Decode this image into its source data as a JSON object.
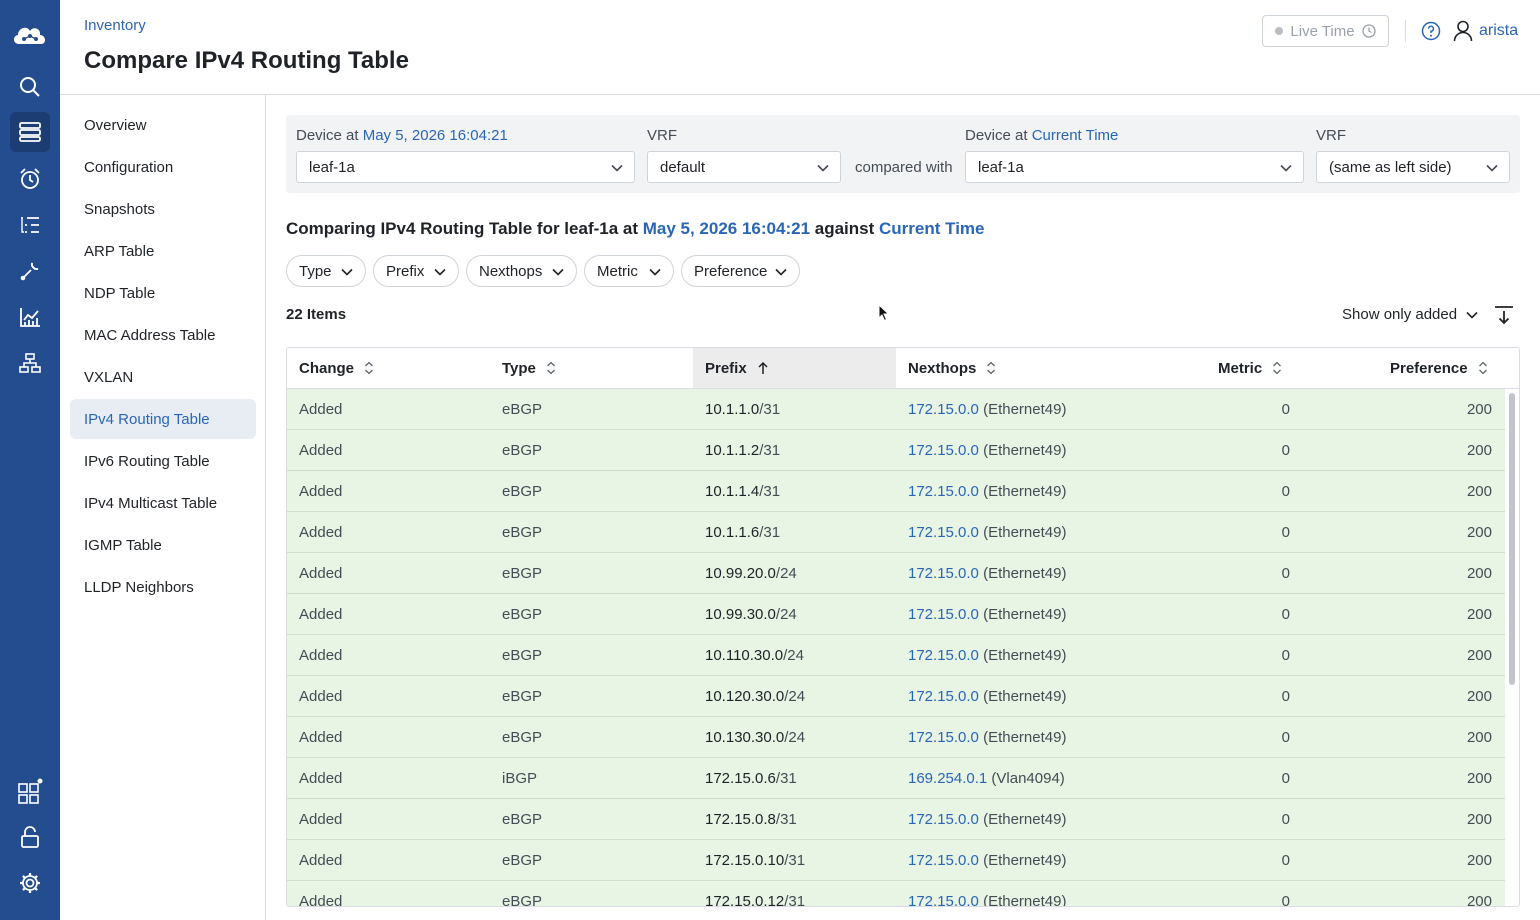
{
  "rail": {
    "items": [
      {
        "name": "cloud-logo-icon"
      },
      {
        "name": "search-icon"
      },
      {
        "name": "devices-icon"
      },
      {
        "name": "events-icon"
      },
      {
        "name": "tasks-icon"
      },
      {
        "name": "provisioning-icon"
      },
      {
        "name": "dashboards-icon"
      },
      {
        "name": "topology-icon"
      },
      {
        "name": "apps-icon"
      },
      {
        "name": "lock-icon"
      },
      {
        "name": "settings-icon"
      }
    ]
  },
  "header": {
    "breadcrumb": "Inventory",
    "title": "Compare IPv4 Routing Table",
    "live_time": "Live Time",
    "user": "arista"
  },
  "subnav": {
    "items": [
      "Overview",
      "Configuration",
      "Snapshots",
      "ARP Table",
      "NDP Table",
      "MAC Address Table",
      "VXLAN",
      "IPv4 Routing Table",
      "IPv6 Routing Table",
      "IPv4 Multicast Table",
      "IGMP Table",
      "LLDP Neighbors"
    ],
    "active": "IPv4 Routing Table"
  },
  "selectors": {
    "left_device_label": "Device at ",
    "left_device_time": "May 5, 2026 16:04:21",
    "left_device_value": "leaf-1a",
    "left_vrf_label": "VRF",
    "left_vrf_value": "default",
    "compared_with": "compared with",
    "right_device_label": "Device at ",
    "right_device_time": "Current Time",
    "right_device_value": "leaf-1a",
    "right_vrf_label": "VRF",
    "right_vrf_value": "(same as left side)"
  },
  "comparison": {
    "prefix": "Comparing IPv4 Routing Table for leaf-1a at ",
    "time_a": "May 5, 2026 16:04:21",
    "against": " against ",
    "time_b": "Current Time"
  },
  "filters": [
    "Type",
    "Prefix",
    "Nexthops",
    "Metric",
    "Preference"
  ],
  "list": {
    "count": "22 Items",
    "show_filter": "Show only added"
  },
  "table": {
    "columns": [
      "Change",
      "Type",
      "Prefix",
      "Nexthops",
      "Metric",
      "Preference"
    ],
    "sorted_column": "Prefix",
    "rows": [
      {
        "change": "Added",
        "type": "eBGP",
        "prefix_ip": "10.1.1.0",
        "prefix_len": "/31",
        "hop_ip": "172.15.0.0",
        "hop_if": " (Ethernet49)",
        "metric": "0",
        "pref": "200"
      },
      {
        "change": "Added",
        "type": "eBGP",
        "prefix_ip": "10.1.1.2",
        "prefix_len": "/31",
        "hop_ip": "172.15.0.0",
        "hop_if": " (Ethernet49)",
        "metric": "0",
        "pref": "200"
      },
      {
        "change": "Added",
        "type": "eBGP",
        "prefix_ip": "10.1.1.4",
        "prefix_len": "/31",
        "hop_ip": "172.15.0.0",
        "hop_if": " (Ethernet49)",
        "metric": "0",
        "pref": "200"
      },
      {
        "change": "Added",
        "type": "eBGP",
        "prefix_ip": "10.1.1.6",
        "prefix_len": "/31",
        "hop_ip": "172.15.0.0",
        "hop_if": " (Ethernet49)",
        "metric": "0",
        "pref": "200"
      },
      {
        "change": "Added",
        "type": "eBGP",
        "prefix_ip": "10.99.20.0",
        "prefix_len": "/24",
        "hop_ip": "172.15.0.0",
        "hop_if": " (Ethernet49)",
        "metric": "0",
        "pref": "200"
      },
      {
        "change": "Added",
        "type": "eBGP",
        "prefix_ip": "10.99.30.0",
        "prefix_len": "/24",
        "hop_ip": "172.15.0.0",
        "hop_if": " (Ethernet49)",
        "metric": "0",
        "pref": "200"
      },
      {
        "change": "Added",
        "type": "eBGP",
        "prefix_ip": "10.110.30.0",
        "prefix_len": "/24",
        "hop_ip": "172.15.0.0",
        "hop_if": " (Ethernet49)",
        "metric": "0",
        "pref": "200"
      },
      {
        "change": "Added",
        "type": "eBGP",
        "prefix_ip": "10.120.30.0",
        "prefix_len": "/24",
        "hop_ip": "172.15.0.0",
        "hop_if": " (Ethernet49)",
        "metric": "0",
        "pref": "200"
      },
      {
        "change": "Added",
        "type": "eBGP",
        "prefix_ip": "10.130.30.0",
        "prefix_len": "/24",
        "hop_ip": "172.15.0.0",
        "hop_if": " (Ethernet49)",
        "metric": "0",
        "pref": "200"
      },
      {
        "change": "Added",
        "type": "iBGP",
        "prefix_ip": "172.15.0.6",
        "prefix_len": "/31",
        "hop_ip": "169.254.0.1",
        "hop_if": " (Vlan4094)",
        "metric": "0",
        "pref": "200"
      },
      {
        "change": "Added",
        "type": "eBGP",
        "prefix_ip": "172.15.0.8",
        "prefix_len": "/31",
        "hop_ip": "172.15.0.0",
        "hop_if": " (Ethernet49)",
        "metric": "0",
        "pref": "200"
      },
      {
        "change": "Added",
        "type": "eBGP",
        "prefix_ip": "172.15.0.10",
        "prefix_len": "/31",
        "hop_ip": "172.15.0.0",
        "hop_if": " (Ethernet49)",
        "metric": "0",
        "pref": "200"
      },
      {
        "change": "Added",
        "type": "eBGP",
        "prefix_ip": "172.15.0.12",
        "prefix_len": "/31",
        "hop_ip": "172.15.0.0",
        "hop_if": " (Ethernet49)",
        "metric": "0",
        "pref": "200"
      }
    ]
  },
  "colors": {
    "rail": "#234d8f",
    "accent": "#2a66b8",
    "added_row": "#e8f4e4"
  }
}
